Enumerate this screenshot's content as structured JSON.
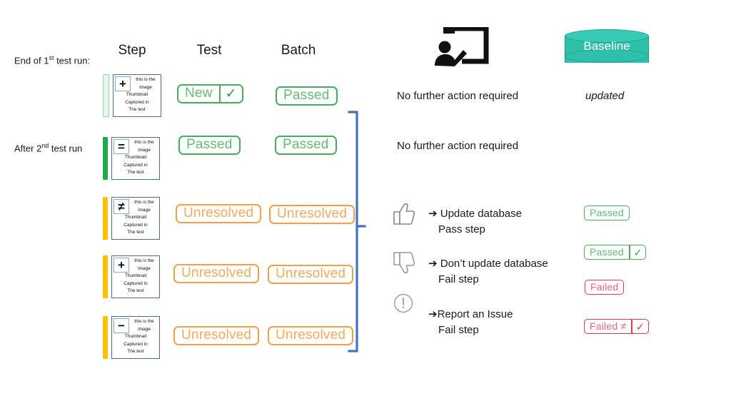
{
  "run_labels": [
    {
      "prefix": "End of 1",
      "sup": "st",
      "suffix": " test run:"
    },
    {
      "prefix": "After  2",
      "sup": "nd",
      "suffix": " test run"
    }
  ],
  "columns": {
    "step": "Step",
    "test": "Test",
    "batch": "Batch"
  },
  "thumbnail_text": {
    "line1": "this is the",
    "line2": "image",
    "line3": "Thumbnail",
    "line4": "Captured in",
    "line5": "The test"
  },
  "rows": [
    {
      "symbol": "+",
      "bar_color": "#b9e6c2",
      "bar_style": "outline",
      "test_label": "New",
      "test_mark": "✓",
      "test_color": "green",
      "batch_label": "Passed",
      "batch_color": "green"
    },
    {
      "symbol": "=",
      "bar_color": "#1faa4b",
      "bar_style": "solid",
      "test_label": "Passed",
      "test_mark": "",
      "test_color": "green",
      "batch_label": "Passed",
      "batch_color": "green"
    },
    {
      "symbol": "≠",
      "bar_color": "#ffc000",
      "bar_style": "solid",
      "test_label": "Unresolved",
      "test_mark": "",
      "test_color": "orange",
      "batch_label": "Unresolved",
      "batch_color": "orange"
    },
    {
      "symbol": "+",
      "bar_color": "#ffc000",
      "bar_style": "solid",
      "test_label": "Unresolved",
      "test_mark": "",
      "test_color": "orange",
      "batch_label": "Unresolved",
      "batch_color": "orange"
    },
    {
      "symbol": "−",
      "bar_color": "#ffc000",
      "bar_style": "solid",
      "test_label": "Unresolved",
      "test_mark": "",
      "test_color": "orange",
      "batch_label": "Unresolved",
      "batch_color": "orange"
    }
  ],
  "top_icons": {
    "reviewer_icon": "presenter-board-icon",
    "baseline_label": "Baseline",
    "baseline_color": "#2ec0ab"
  },
  "notes": {
    "no_action_1": "No further action required",
    "no_action_2": "No further action required",
    "updated": "updated"
  },
  "actions": [
    {
      "icon": "thumbs-up-icon",
      "line1": "➔ Update database",
      "line2": "Pass step",
      "result_label": "Passed",
      "result_mark": "",
      "result_color": "green"
    },
    {
      "icon": "thumbs-down-icon",
      "line1": "➔ Don’t update database",
      "line2": "Fail  step",
      "result_label": "Passed",
      "result_mark": "✓",
      "result_color": "green"
    },
    {
      "icon": "exclamation-circle-icon",
      "line1": "➔Report an Issue",
      "line2": "Fail step",
      "result_label": "Failed",
      "result_mark": "",
      "result_color": "red"
    },
    {
      "icon": "",
      "line1": "",
      "line2": "",
      "result_label": "Failed ≠",
      "result_mark": "✓",
      "result_color": "red"
    }
  ],
  "bracket": {
    "color": "#4472C4"
  }
}
